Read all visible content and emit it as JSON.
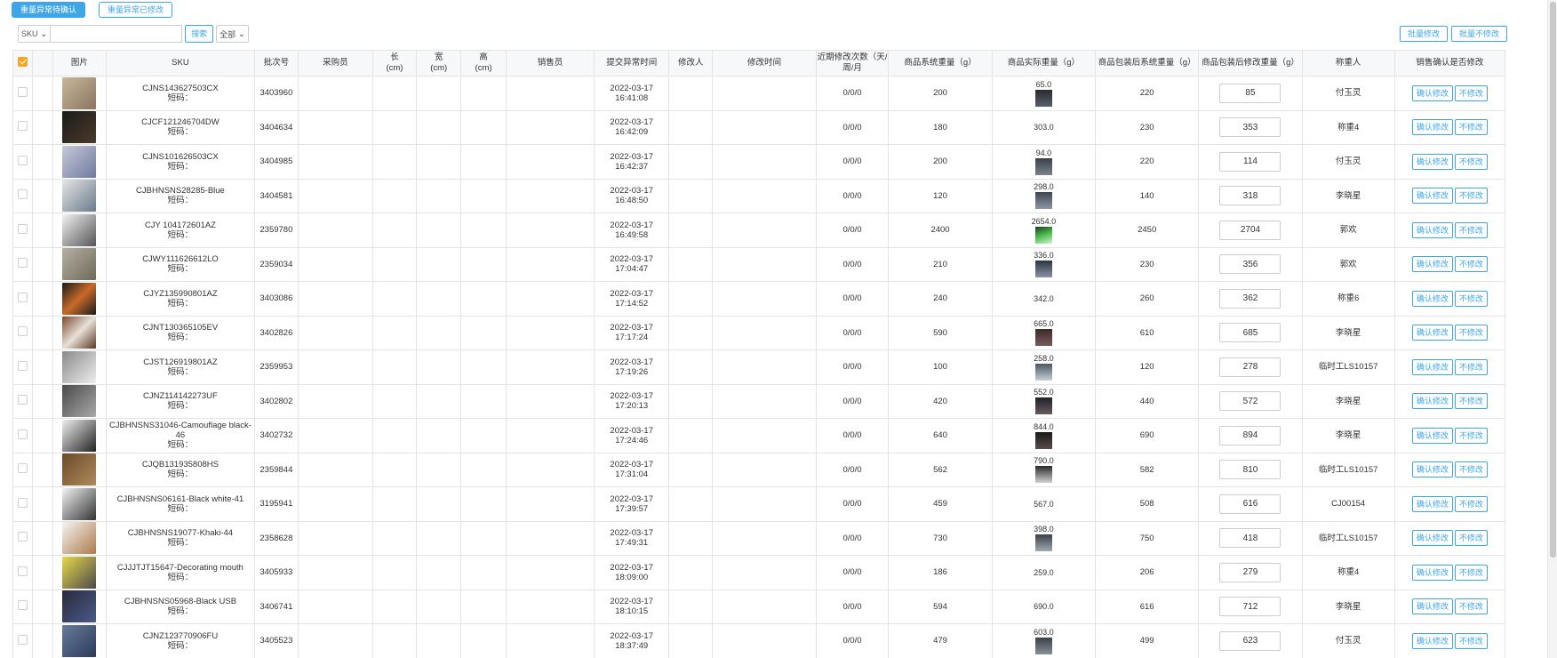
{
  "tabs": [
    {
      "label": "重量异常待确认",
      "active": true
    },
    {
      "label": "重量异常已修改",
      "active": false
    }
  ],
  "filter": {
    "field_select": "SKU",
    "search_value": "",
    "search_button": "搜索",
    "scope_select": "全部"
  },
  "actions": {
    "batch_modify": "批量修改",
    "batch_no_modify": "批量不修改"
  },
  "columns": [
    "图片",
    "SKU",
    "批次号",
    "采购员",
    "长\n(cm)",
    "宽\n(cm)",
    "高\n(cm)",
    "销售员",
    "提交异常时间",
    "修改人",
    "修改时间",
    "近期修改次数（天/周/月",
    "商品系统重量（g）",
    "商品实际重量（g）",
    "商品包装后系统重量（g）",
    "商品包装后修改重量（g）",
    "称重人",
    "销售确认是否修改"
  ],
  "row_actions": {
    "confirm": "确认修改",
    "reject": "不修改"
  },
  "short_code_label": "短码：",
  "colors": {
    "accent": "#3fa6e6",
    "checkbox_checked": "#f5a623"
  },
  "rows": [
    {
      "sku": "CJNS143627503CX",
      "batch": "3403960",
      "date": "2022-03-17",
      "time": "16:41:08",
      "count": "0/0/0",
      "sys_w": "200",
      "act_w": "65.0",
      "pkg_sys": "220",
      "pkg_mod": "85",
      "weigher": "付玉灵",
      "img": "linear-gradient(135deg,#c9b79c,#8a7560)",
      "mini": "linear-gradient(180deg,#2a2a30,#56606a)"
    },
    {
      "sku": "CJCF121246704DW",
      "batch": "3404634",
      "date": "2022-03-17",
      "time": "16:42:09",
      "count": "0/0/0",
      "sys_w": "180",
      "act_w": "303.0",
      "pkg_sys": "230",
      "pkg_mod": "353",
      "weigher": "称重4",
      "img": "linear-gradient(135deg,#1b1b1b,#4a3a2a)",
      "mini": ""
    },
    {
      "sku": "CJNS101626503CX",
      "batch": "3404985",
      "date": "2022-03-17",
      "time": "16:42:37",
      "count": "0/0/0",
      "sys_w": "200",
      "act_w": "94.0",
      "pkg_sys": "220",
      "pkg_mod": "114",
      "weigher": "付玉灵",
      "img": "linear-gradient(135deg,#c7c9d8,#6f7aa0)",
      "mini": "linear-gradient(180deg,#3a3f48,#7b828c)"
    },
    {
      "sku": "CJBHNSNS28285-Blue",
      "batch": "3404581",
      "date": "2022-03-17",
      "time": "16:48:50",
      "count": "0/0/0",
      "sys_w": "120",
      "act_w": "298.0",
      "pkg_sys": "140",
      "pkg_mod": "318",
      "weigher": "李晓星",
      "img": "linear-gradient(135deg,#e6e6e6,#6a7a8a)",
      "mini": "linear-gradient(180deg,#3c4450,#8e98a4)"
    },
    {
      "sku": "CJY 104172601AZ",
      "batch": "2359780",
      "date": "2022-03-17",
      "time": "16:49:58",
      "count": "0/0/0",
      "sys_w": "2400",
      "act_w": "2654.0",
      "pkg_sys": "2450",
      "pkg_mod": "2704",
      "weigher": "郭欢",
      "img": "linear-gradient(135deg,#f2f2f2,#555555)",
      "mini": "linear-gradient(160deg,#1f3a20,#4bbf4f,#d7f0d0)"
    },
    {
      "sku": "CJWY111626612LO",
      "batch": "2359034",
      "date": "2022-03-17",
      "time": "17:04:47",
      "count": "0/0/0",
      "sys_w": "210",
      "act_w": "336.0",
      "pkg_sys": "230",
      "pkg_mod": "356",
      "weigher": "郭欢",
      "img": "linear-gradient(135deg,#b5b0a0,#6e6a5c)",
      "mini": "linear-gradient(180deg,#2d3340,#8a93a6)"
    },
    {
      "sku": "CJYZ135990801AZ",
      "batch": "3403086",
      "date": "2022-03-17",
      "time": "17:14:52",
      "count": "0/0/0",
      "sys_w": "240",
      "act_w": "342.0",
      "pkg_sys": "260",
      "pkg_mod": "362",
      "weigher": "称重6",
      "img": "linear-gradient(135deg,#1a1a1a,#c96a2a,#1a1a1a)",
      "mini": ""
    },
    {
      "sku": "CJNT130365105EV",
      "batch": "3402826",
      "date": "2022-03-17",
      "time": "17:17:24",
      "count": "0/0/0",
      "sys_w": "590",
      "act_w": "665.0",
      "pkg_sys": "610",
      "pkg_mod": "685",
      "weigher": "李晓星",
      "img": "linear-gradient(135deg,#7a4a2a,#e8e0d8,#5a3a20)",
      "mini": "linear-gradient(180deg,#3a2a2a,#7a5a5a)"
    },
    {
      "sku": "CJST126919801AZ",
      "batch": "2359953",
      "date": "2022-03-17",
      "time": "17:19:26",
      "count": "0/0/0",
      "sys_w": "100",
      "act_w": "258.0",
      "pkg_sys": "120",
      "pkg_mod": "278",
      "weigher": "临时工LS10157",
      "img": "linear-gradient(135deg,#8a8a8a,#eeeeee)",
      "mini": "linear-gradient(180deg,#4a5560,#c8d0d8)"
    },
    {
      "sku": "CJNZ114142273UF",
      "batch": "3402802",
      "date": "2022-03-17",
      "time": "17:20:13",
      "count": "0/0/0",
      "sys_w": "420",
      "act_w": "552.0",
      "pkg_sys": "440",
      "pkg_mod": "572",
      "weigher": "李晓星",
      "img": "linear-gradient(135deg,#4a4a4a,#a9a9a9)",
      "mini": "linear-gradient(180deg,#1e2228,#6a5a60)"
    },
    {
      "sku": "CJBHNSNS31046-Camouflage black-46",
      "batch": "3402732",
      "date": "2022-03-17",
      "time": "17:24:46",
      "count": "0/0/0",
      "sys_w": "640",
      "act_w": "844.0",
      "pkg_sys": "690",
      "pkg_mod": "894",
      "weigher": "李晓星",
      "img": "linear-gradient(135deg,#f0f0f0,#222222)",
      "mini": "linear-gradient(180deg,#1a1a1a,#5a4a4a)"
    },
    {
      "sku": "CJQB131935808HS",
      "batch": "2359844",
      "date": "2022-03-17",
      "time": "17:31:04",
      "count": "0/0/0",
      "sys_w": "562",
      "act_w": "790.0",
      "pkg_sys": "582",
      "pkg_mod": "810",
      "weigher": "临时工LS10157",
      "img": "linear-gradient(135deg,#6a4a2a,#b08a5a)",
      "mini": "linear-gradient(180deg,#2a2a2a,#d0d0d0)"
    },
    {
      "sku": "CJBHNSNS06161-Black white-41",
      "batch": "3195941",
      "date": "2022-03-17",
      "time": "17:39:57",
      "count": "0/0/0",
      "sys_w": "459",
      "act_w": "567.0",
      "pkg_sys": "508",
      "pkg_mod": "616",
      "weigher": "CJ00154",
      "img": "linear-gradient(135deg,#f4f4f4,#333333)",
      "mini": ""
    },
    {
      "sku": "CJBHNSNS19077-Khaki-44",
      "batch": "2358628",
      "date": "2022-03-17",
      "time": "17:49:31",
      "count": "0/0/0",
      "sys_w": "730",
      "act_w": "398.0",
      "pkg_sys": "750",
      "pkg_mod": "418",
      "weigher": "临时工LS10157",
      "img": "linear-gradient(135deg,#f4f4f4,#b07a4a)",
      "mini": "linear-gradient(180deg,#3a4048,#a0a8b0)"
    },
    {
      "sku": "CJJJTJT15647-Decorating mouth",
      "batch": "3405933",
      "date": "2022-03-17",
      "time": "18:09:00",
      "count": "0/0/0",
      "sys_w": "186",
      "act_w": "259.0",
      "pkg_sys": "206",
      "pkg_mod": "279",
      "weigher": "称重4",
      "img": "linear-gradient(135deg,#e8d84a,#4a4a4a)",
      "mini": ""
    },
    {
      "sku": "CJBHNSNS05968-Black USB",
      "batch": "3406741",
      "date": "2022-03-17",
      "time": "18:10:15",
      "count": "0/0/0",
      "sys_w": "594",
      "act_w": "690.0",
      "pkg_sys": "616",
      "pkg_mod": "712",
      "weigher": "李晓星",
      "img": "linear-gradient(135deg,#2a2a3a,#4a5a8a)",
      "mini": ""
    },
    {
      "sku": "CJNZ123770906FU",
      "batch": "3405523",
      "date": "2022-03-17",
      "time": "18:37:49",
      "count": "0/0/0",
      "sys_w": "479",
      "act_w": "603.0",
      "pkg_sys": "499",
      "pkg_mod": "623",
      "weigher": "付玉灵",
      "img": "linear-gradient(135deg,#6a7a9a,#2a3a5a)",
      "mini": "linear-gradient(180deg,#3a4048,#8a9098)"
    }
  ]
}
